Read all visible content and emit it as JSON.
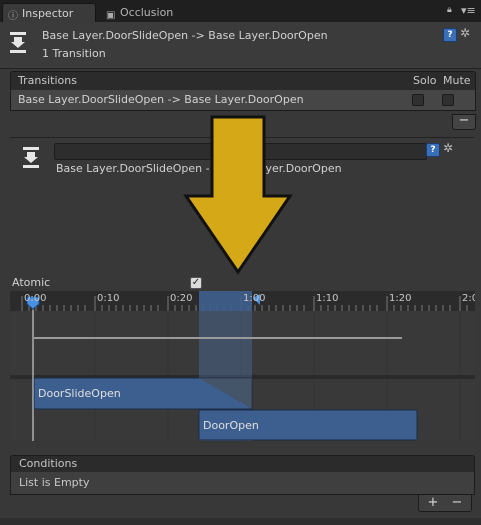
{
  "tabs": [
    {
      "label": "Inspector",
      "icon": "info-icon"
    },
    {
      "label": "Occlusion",
      "icon": "occlusion-icon"
    }
  ],
  "header": {
    "title": "Base Layer.DoorSlideOpen -> Base Layer.DoorOpen",
    "subtitle": "1 Transition"
  },
  "transitions": {
    "title": "Transitions",
    "solo_label": "Solo",
    "mute_label": "Mute",
    "rows": [
      {
        "label": "Base Layer.DoorSlideOpen -> Base Layer.DoorOpen",
        "solo": false,
        "mute": false
      }
    ],
    "remove_label": "−"
  },
  "detail": {
    "name_value": "",
    "label": "Base Layer.DoorSlideOpen -> Base Layer.DoorOpen"
  },
  "atomic": {
    "label": "Atomic",
    "checked": true
  },
  "timeline": {
    "ticks": [
      "0:00",
      "0:10",
      "0:20",
      "1:00",
      "1:10",
      "1:20",
      "2:0"
    ],
    "clips": [
      {
        "name": "DoorSlideOpen",
        "color": "#3d5f8f"
      },
      {
        "name": "DoorOpen",
        "color": "#3d5f8f"
      }
    ]
  },
  "conditions": {
    "title": "Conditions",
    "empty_text": "List is Empty",
    "add_label": "+",
    "remove_label": "−"
  },
  "colors": {
    "accent": "#3d5f8f",
    "arrow_fill": "#d4a817",
    "arrow_stroke": "#111111"
  }
}
